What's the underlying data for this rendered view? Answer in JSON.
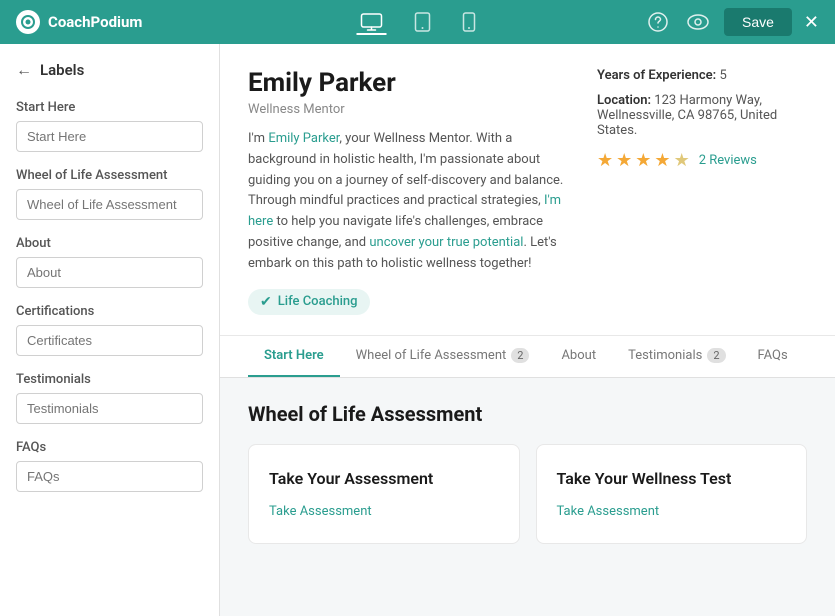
{
  "header": {
    "logo_text": "CoachPodium",
    "nav_items": [
      {
        "label": "Desktop",
        "icon": "desktop",
        "active": true
      },
      {
        "label": "Tablet",
        "icon": "tablet",
        "active": false
      },
      {
        "label": "Mobile",
        "icon": "mobile",
        "active": false
      }
    ],
    "right_icons": [
      "help",
      "eye"
    ],
    "save_label": "Save",
    "close_label": "✕"
  },
  "sidebar": {
    "back_label": "←",
    "title": "Labels",
    "sections": [
      {
        "label": "Start Here",
        "placeholder": "Start Here"
      },
      {
        "label": "Wheel of Life Assessment",
        "placeholder": "Wheel of Life Assessment"
      },
      {
        "label": "About",
        "placeholder": "About"
      },
      {
        "label": "Certifications",
        "placeholder": "Certificates"
      },
      {
        "label": "Testimonials",
        "placeholder": "Testimonials"
      },
      {
        "label": "FAQs",
        "placeholder": "FAQs"
      }
    ]
  },
  "profile": {
    "name": "Emily Parker",
    "role": "Wellness Mentor",
    "bio": "I'm Emily Parker, your Wellness Mentor. With a background in holistic health, I'm passionate about guiding you on a journey of self-discovery and balance. Through mindful practices and practical strategies, I'm here to help you navigate life's challenges, embrace positive change, and uncover your true potential. Let's embark on this path to holistic wellness together!",
    "tag": "Life Coaching",
    "years_of_experience_label": "Years of Experience:",
    "years_of_experience_value": "5",
    "location_label": "Location:",
    "location_value": "123 Harmony Way, Wellnessville, CA 98765, United States.",
    "stars": 4.5,
    "star_count": 5,
    "reviews_count": "2 Reviews"
  },
  "tabs": [
    {
      "label": "Start Here",
      "badge": null,
      "active": true
    },
    {
      "label": "Wheel of Life Assessment",
      "badge": "2",
      "active": false
    },
    {
      "label": "About",
      "badge": null,
      "active": false
    },
    {
      "label": "Testimonials",
      "badge": "2",
      "active": false
    },
    {
      "label": "FAQs",
      "badge": null,
      "active": false
    }
  ],
  "tab_content": {
    "heading": "Wheel of Life Assessment",
    "cards": [
      {
        "title": "Take Your Assessment",
        "link_label": "Take Assessment"
      },
      {
        "title": "Take Your Wellness Test",
        "link_label": "Take Assessment"
      }
    ]
  }
}
